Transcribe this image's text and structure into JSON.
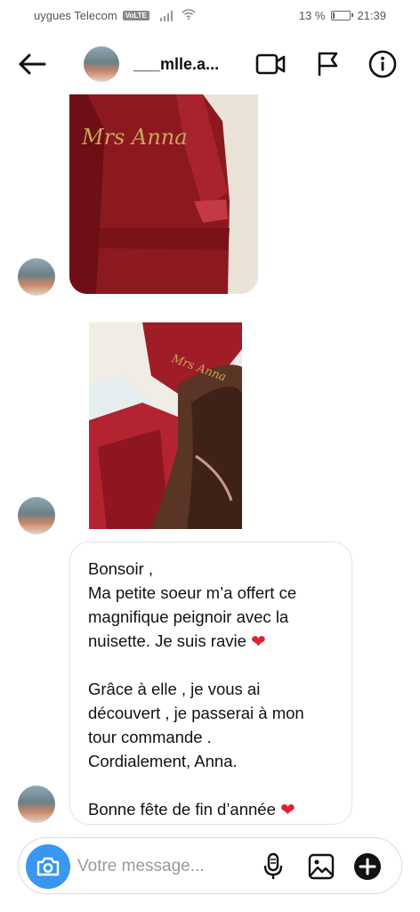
{
  "status_bar": {
    "carrier": "uygues Telecom",
    "volte": "VoLTE",
    "battery_text": "13 %",
    "battery_level": 0.13,
    "time": "21:39"
  },
  "header": {
    "username": "___mlle.a...",
    "icons": [
      "back-arrow-icon",
      "video-camera-icon",
      "flag-icon",
      "info-icon"
    ]
  },
  "photos": {
    "photo1_embroidery": "Mrs Anna",
    "photo2_embroidery": "Mrs Anna"
  },
  "message": {
    "line1": "Bonsoir ,",
    "line2": "Ma petite soeur m’a offert ce",
    "line3": "magnifique peignoir avec la",
    "line4": "nuisette. Je suis ravie",
    "line5": "Grâce à elle , je vous ai",
    "line6": "découvert , je passerai à mon",
    "line7": "tour commande .",
    "line8": "Cordialement, Anna.",
    "line9": "Bonne fête de fin d’année",
    "heart_emoji": "❤",
    "heart_color": "#e0212f"
  },
  "composer": {
    "placeholder": "Votre message...",
    "accent": "#3897f0",
    "icons": [
      "camera-icon",
      "microphone-icon",
      "image-icon",
      "plus-icon"
    ]
  }
}
